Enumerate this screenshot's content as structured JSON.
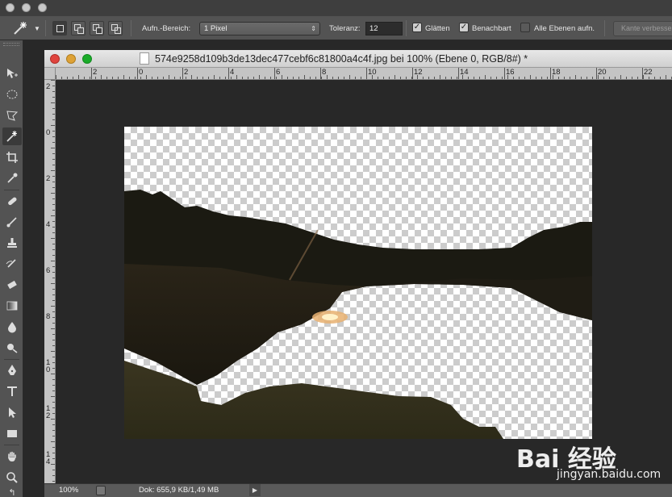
{
  "options_bar": {
    "sample_size_label": "Aufn.-Bereich:",
    "sample_size_value": "1 Pixel",
    "tolerance_label": "Toleranz:",
    "tolerance_value": "12",
    "anti_alias_label": "Glätten",
    "anti_alias_checked": true,
    "contiguous_label": "Benachbart",
    "contiguous_checked": true,
    "all_layers_label": "Alle Ebenen aufn.",
    "all_layers_checked": false,
    "refine_edge_label": "Kante verbessern..."
  },
  "tools": [
    {
      "name": "move-tool",
      "active": false
    },
    {
      "name": "marquee-tool",
      "active": false
    },
    {
      "name": "lasso-tool",
      "active": false
    },
    {
      "name": "magic-wand-tool",
      "active": true
    },
    {
      "name": "crop-tool",
      "active": false
    },
    {
      "name": "eyedropper-tool",
      "active": false
    },
    {
      "name": "healing-brush-tool",
      "active": false
    },
    {
      "name": "brush-tool",
      "active": false
    },
    {
      "name": "clone-stamp-tool",
      "active": false
    },
    {
      "name": "history-brush-tool",
      "active": false
    },
    {
      "name": "eraser-tool",
      "active": false
    },
    {
      "name": "gradient-tool",
      "active": false
    },
    {
      "name": "blur-tool",
      "active": false
    },
    {
      "name": "dodge-tool",
      "active": false
    },
    {
      "name": "pen-tool",
      "active": false
    },
    {
      "name": "type-tool",
      "active": false
    },
    {
      "name": "path-selection-tool",
      "active": false
    },
    {
      "name": "rectangle-tool",
      "active": false
    },
    {
      "name": "hand-tool",
      "active": false
    },
    {
      "name": "zoom-tool",
      "active": false
    }
  ],
  "document": {
    "title": "574e9258d109b3de13dec477cebf6c81800a4c4f.jpg bei 100% (Ebene 0, RGB/8#) *",
    "h_ruler_labels": [
      "2",
      "0",
      "2",
      "4",
      "6",
      "8",
      "10",
      "12",
      "14",
      "16",
      "18",
      "20",
      "22"
    ],
    "v_ruler_labels": [
      "2",
      "0",
      "2",
      "4",
      "6",
      "8",
      "1\n0",
      "1\n2",
      "1\n4"
    ]
  },
  "status": {
    "zoom": "100%",
    "doc_info": "Dok: 655,9 KB/1,49 MB"
  },
  "watermark": {
    "logo": "Bai 经验",
    "url": "jingyan.baidu.com"
  },
  "colors": {
    "panel": "#535353",
    "background": "#282828",
    "close": "#e0443e",
    "minimize": "#dea236",
    "maximize": "#1aab29"
  }
}
